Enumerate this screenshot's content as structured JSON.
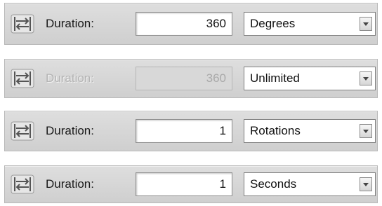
{
  "rows": [
    {
      "label": "Duration:",
      "value": "360",
      "unit": "Degrees",
      "enabled": true,
      "icon": "duration-arrows-icon"
    },
    {
      "label": "Duration:",
      "value": "360",
      "unit": "Unlimited",
      "enabled": false,
      "icon": "duration-arrows-icon"
    },
    {
      "label": "Duration:",
      "value": "1",
      "unit": "Rotations",
      "enabled": true,
      "icon": "duration-arrows-icon"
    },
    {
      "label": "Duration:",
      "value": "1",
      "unit": "Seconds",
      "enabled": true,
      "icon": "duration-arrows-icon"
    }
  ],
  "colors": {
    "panel": "#d6d6d6",
    "disabled_text": "#b4b4b4",
    "text": "#1a1a1a"
  }
}
